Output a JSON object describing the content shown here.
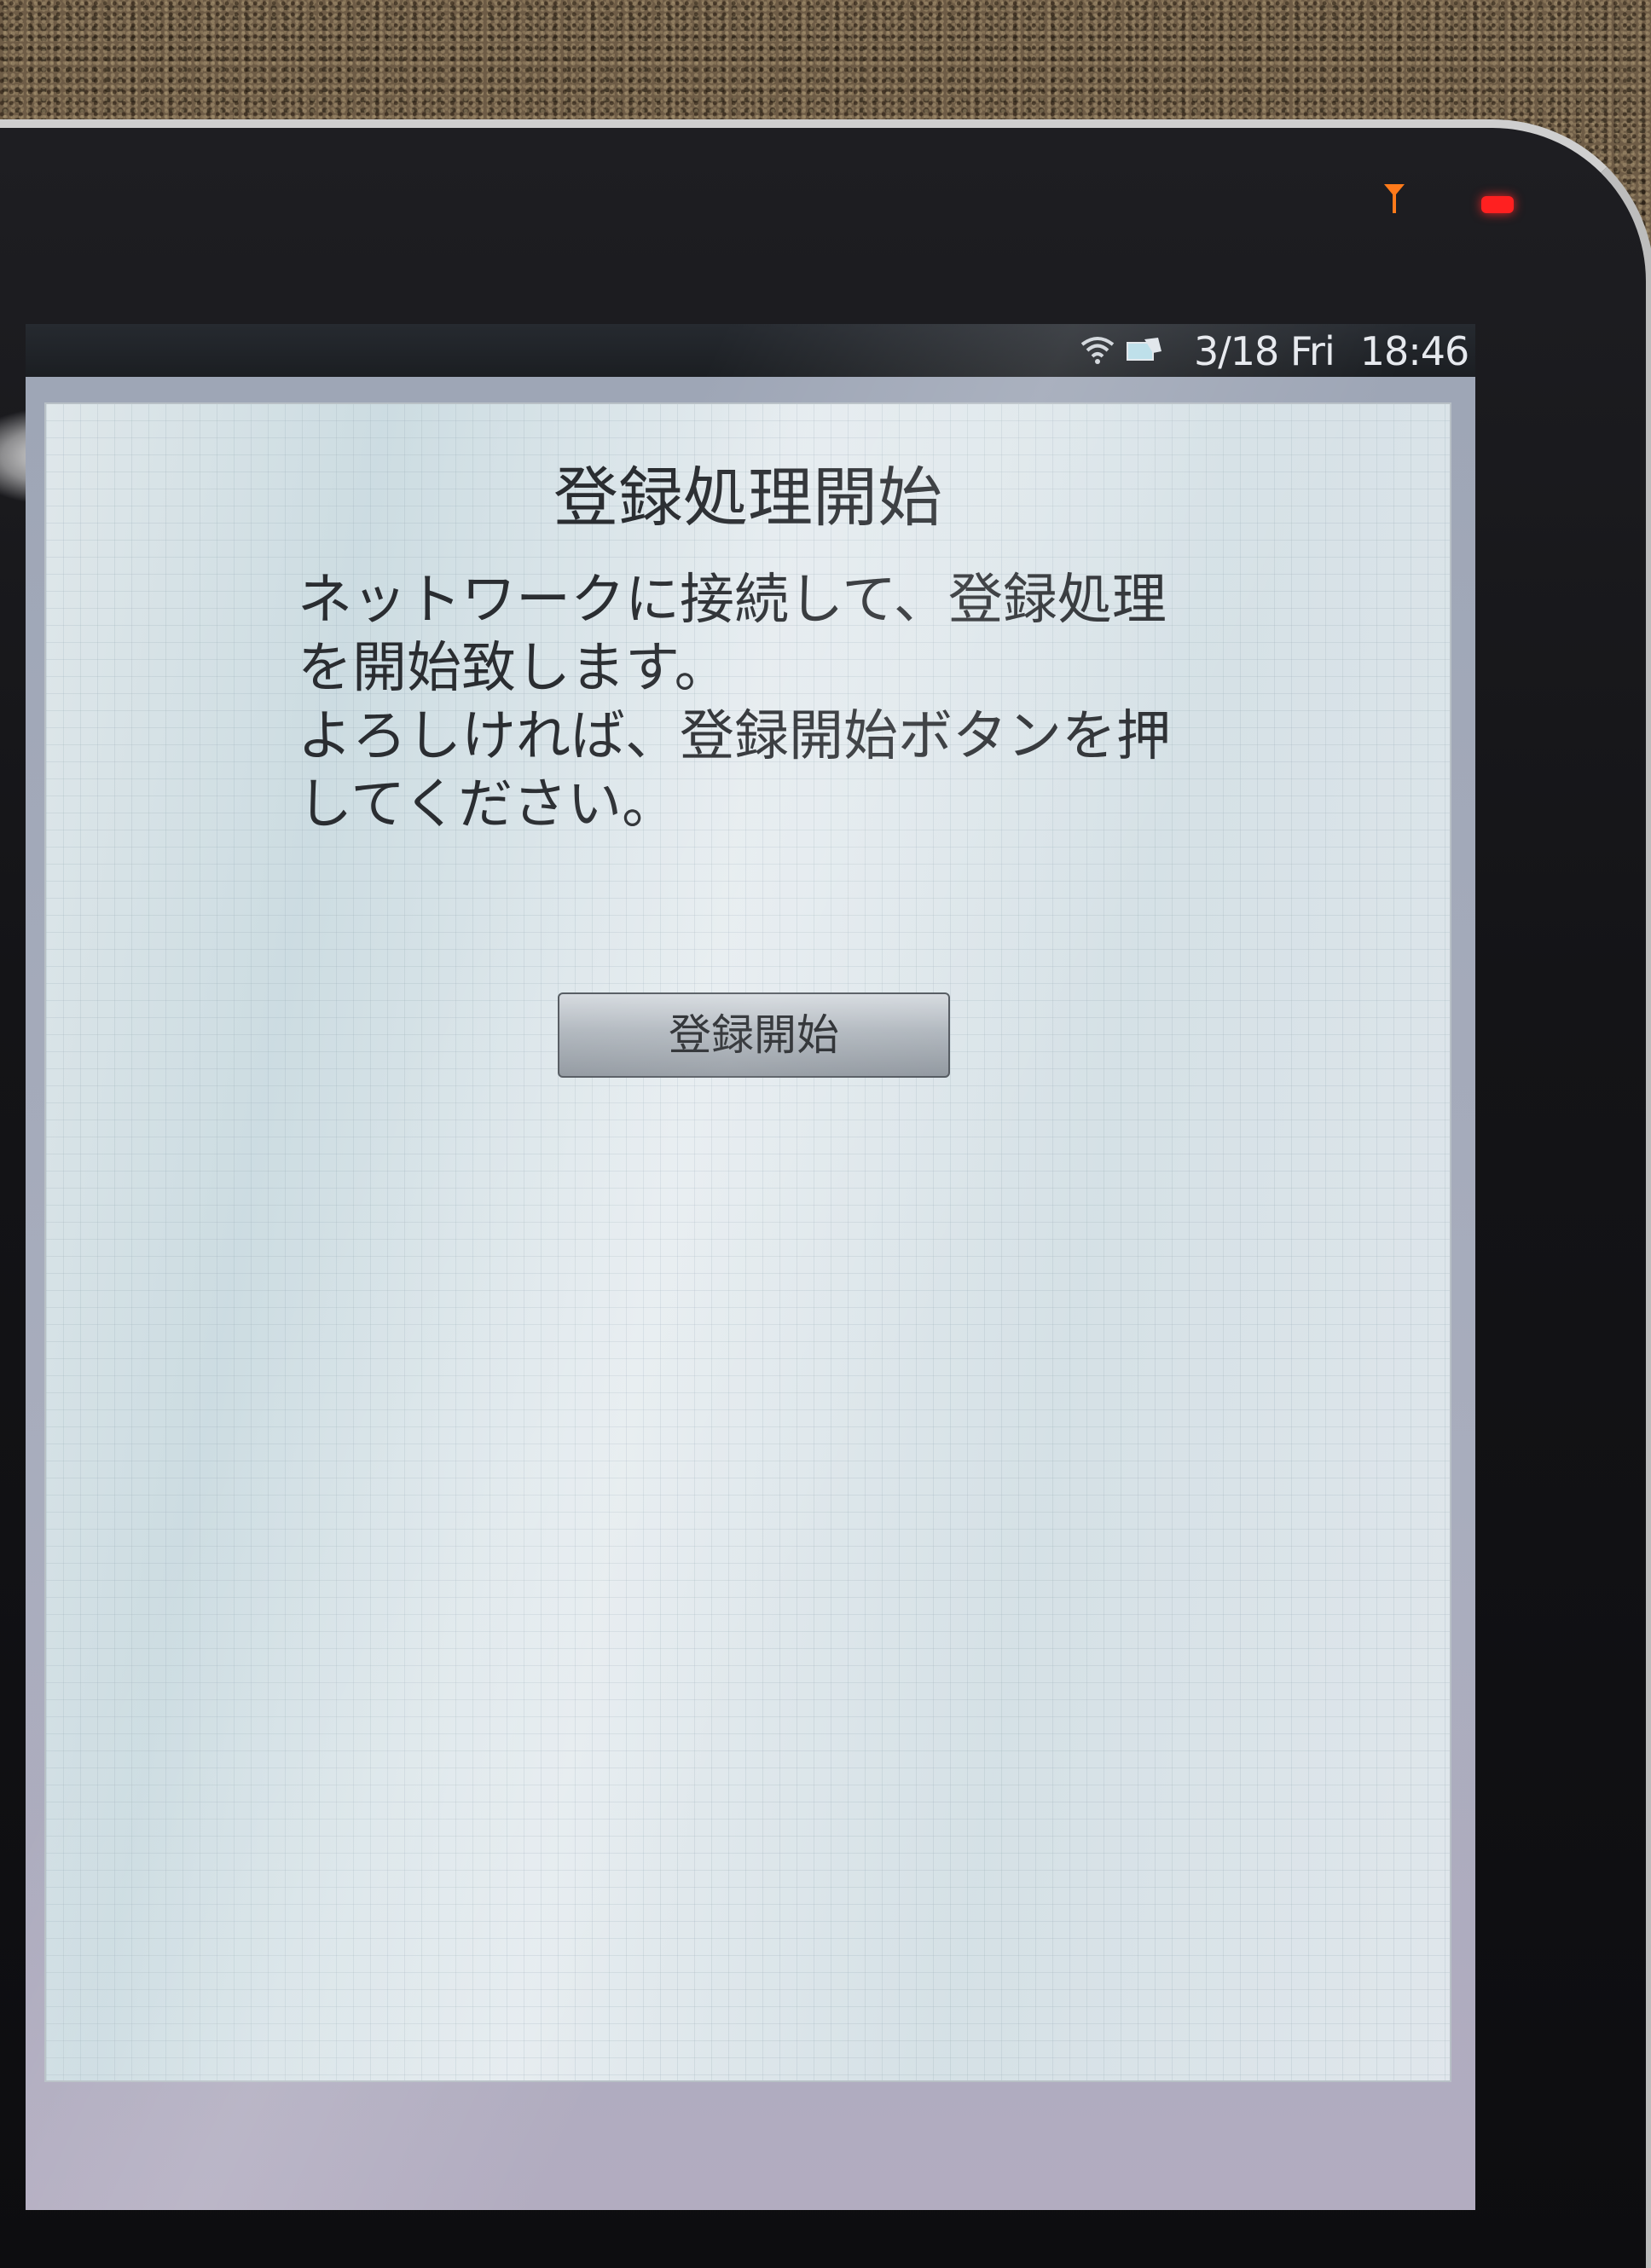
{
  "status_bar": {
    "icons": [
      "wifi-icon",
      "sd-card-icon"
    ],
    "date": "3/18 Fri",
    "time": "18:46"
  },
  "dialog": {
    "title": "登録処理開始",
    "message_lines": [
      "ネットワークに接続して、登録処理",
      "を開始致します。",
      "よろしければ、登録開始ボタンを押",
      "してください。"
    ],
    "start_button_label": "登録開始"
  },
  "colors": {
    "indicator_led": "#ff2020",
    "indicator_antenna": "#ff7a1a",
    "dialog_background": "#dfe7ea"
  }
}
